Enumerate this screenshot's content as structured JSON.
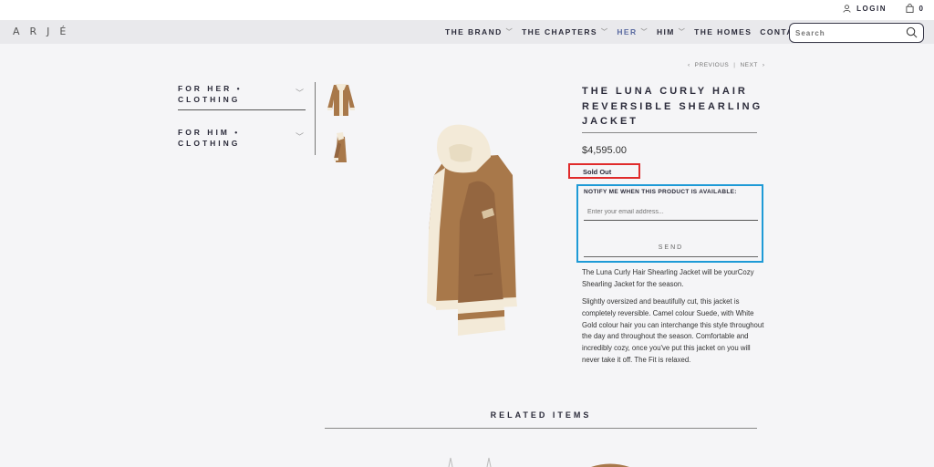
{
  "header": {
    "login_label": "LOGIN",
    "cart_count": "0",
    "logo_text": "ARJÉ",
    "search_placeholder": "Search"
  },
  "nav": {
    "items": [
      {
        "label": "THE BRAND",
        "has_dropdown": true
      },
      {
        "label": "THE CHAPTERS",
        "has_dropdown": true
      },
      {
        "label": "HER",
        "has_dropdown": true
      },
      {
        "label": "HIM",
        "has_dropdown": true
      },
      {
        "label": "THE HOMES",
        "has_dropdown": false
      },
      {
        "label": "CONTACTS",
        "has_dropdown": false
      }
    ]
  },
  "sidebar": {
    "sections": [
      {
        "label": "FOR HER • CLOTHING"
      },
      {
        "label": "FOR HIM • CLOTHING"
      }
    ]
  },
  "pager": {
    "previous": "PREVIOUS",
    "separator": "|",
    "next": "NEXT"
  },
  "product": {
    "title": "THE LUNA CURLY HAIR REVERSIBLE SHEARLING JACKET",
    "price": "$4,595.00",
    "status": "Sold Out",
    "notify_label": "NOTIFY ME WHEN THIS PRODUCT IS AVAILABLE:",
    "email_placeholder": "Enter your email address...",
    "send_label": "SEND",
    "description_1": "The Luna Curly Hair Shearling Jacket will be yourCozy Shearling Jacket for the season.",
    "description_2": "Slightly oversized and beautifully cut, this jacket is completely reversible. Camel colour Suede, with White Gold colour hair you can interchange this style throughout the day and throughout the season. Comfortable and incredibly cozy, once you've put this jacket on you will never take it off. The Fit is relaxed."
  },
  "related": {
    "title": "RELATED ITEMS"
  },
  "colors": {
    "sold_out_highlight": "#e02b2b",
    "notify_highlight": "#1e9ad6",
    "nav_accent": "#5a6aa0",
    "suede": "#a8784a",
    "shearling": "#f3ead8"
  }
}
